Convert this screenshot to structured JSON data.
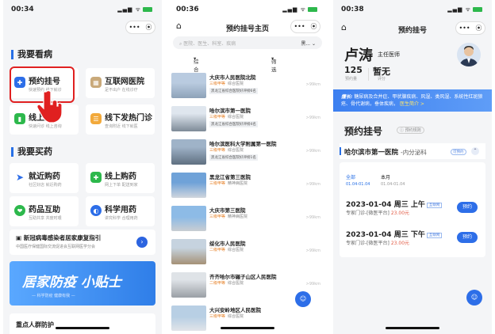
{
  "screen1": {
    "time": "00:34",
    "section_see": "我要看病",
    "cards": [
      {
        "title": "预约挂号",
        "sub": "快速预约 线下就诊",
        "icon": "hospital-icon",
        "color": "#2d6ee8"
      },
      {
        "title": "互联网医院",
        "sub": "足不出户 在线诊疗",
        "icon": "building-icon",
        "color": "#c9a97a"
      },
      {
        "title": "线上问诊",
        "sub": "快速问诊 线上咨询",
        "icon": "thermometer-icon",
        "color": "#2db84c"
      },
      {
        "title": "线下发热门诊",
        "sub": "查询附近 线下就医",
        "icon": "clipboard-icon",
        "color": "#f2a93b"
      }
    ],
    "section_buy": "我要买药",
    "drug_cards": [
      {
        "title": "就近购药",
        "sub": "社区好店 就近购药",
        "icon": "location-arrow-icon",
        "color": "#2d6ee8"
      },
      {
        "title": "线上购药",
        "sub": "网上下单 配送到家",
        "icon": "medicine-box-icon",
        "color": "#2db84c"
      },
      {
        "title": "药品互助",
        "sub": "互助共享 共度时艰",
        "icon": "handshake-icon",
        "color": "#2db84c"
      },
      {
        "title": "科学用药",
        "sub": "讲究科学 合理用药",
        "icon": "capsule-icon",
        "color": "#2d6ee8"
      }
    ],
    "notice_title": "新冠病毒感染者居家康复指引",
    "notice_sub": "中国医疗保健国际交流促进会互联网医学分会",
    "banner_text": "居家防疫 小贴士",
    "banner_sub": "— 科学防疫 健康有我 —",
    "bottom_title": "重点人群防护"
  },
  "screen2": {
    "time": "00:36",
    "title": "预约挂号主页",
    "search_placeholder": "医院、医生、科室、疾病",
    "city": "黑...",
    "sort_label": "综合排序",
    "filter_label": "筛选",
    "hospitals": [
      {
        "name": "大庆市人民医院北院",
        "grade": "三级甲等",
        "type": "综合医院",
        "tag": "黑龙江省综合医院好评榜6名",
        "dist": ">99km"
      },
      {
        "name": "哈尔滨市第一医院",
        "grade": "三级甲等",
        "type": "综合医院",
        "tag": "黑龙江省综合医院好评榜4名",
        "dist": ">99km"
      },
      {
        "name": "哈尔滨医科大学附属第一医院",
        "grade": "三级甲等",
        "type": "综合医院",
        "tag": "黑龙江省综合医院好评榜1名",
        "dist": ">99km"
      },
      {
        "name": "黑龙江省第三医院",
        "grade": "三级甲等",
        "type": "精神病医院",
        "tag": "",
        "dist": ">99km"
      },
      {
        "name": "大庆市第三医院",
        "grade": "三级甲等",
        "type": "精神病医院",
        "tag": "",
        "dist": ">99km"
      },
      {
        "name": "绥化市人民医院",
        "grade": "二级甲等",
        "type": "综合医院",
        "tag": "",
        "dist": ">99km"
      },
      {
        "name": "齐齐哈尔市碾子山区人民医院",
        "grade": "二级甲等",
        "type": "综合医院",
        "tag": "",
        "dist": ">99km"
      },
      {
        "name": "大兴安岭地区人民医院",
        "grade": "三级甲等",
        "type": "综合医院",
        "tag": "",
        "dist": ">99km"
      }
    ],
    "float_label": "客服"
  },
  "screen3": {
    "time": "00:38",
    "title": "预约挂号",
    "doctor_name": "卢涛",
    "doctor_title": "主任医师",
    "stat1_value": "125",
    "stat1_label": "预约量",
    "stat2_value": "暂无",
    "stat2_label": "评分",
    "skill_label": "擅长:",
    "skill_text": "糖尿病及合并症、甲状腺疾病、风湿、类风湿、系统性红斑狼疮、骨代谢病，垂体疾病，",
    "skill_more": "医生简介 >",
    "sched_title": "预约挂号",
    "sched_tag": "预约规则",
    "hospital": "哈尔滨市第一医院",
    "department": "-内分泌科",
    "hosp_tag": "可预约",
    "date_all_label": "全部",
    "date_all_range": "01.04-01.04",
    "date_month_label": "本月",
    "date_month_range": "01.04-01.04",
    "slots": [
      {
        "date": "2023-01-04 周三 上午",
        "tag": "互联网",
        "desc": "专家门诊-[微医平台]",
        "price": "23.00元",
        "btn": "预约"
      },
      {
        "date": "2023-01-04 周三 下午",
        "tag": "互联网",
        "desc": "专家门诊-[微医平台]",
        "price": "23.00元",
        "btn": "预约"
      }
    ],
    "float_label": "客服"
  },
  "colors": {
    "accent": "#2d6ee8",
    "highlight": "#e02020",
    "price": "#e25b45"
  }
}
